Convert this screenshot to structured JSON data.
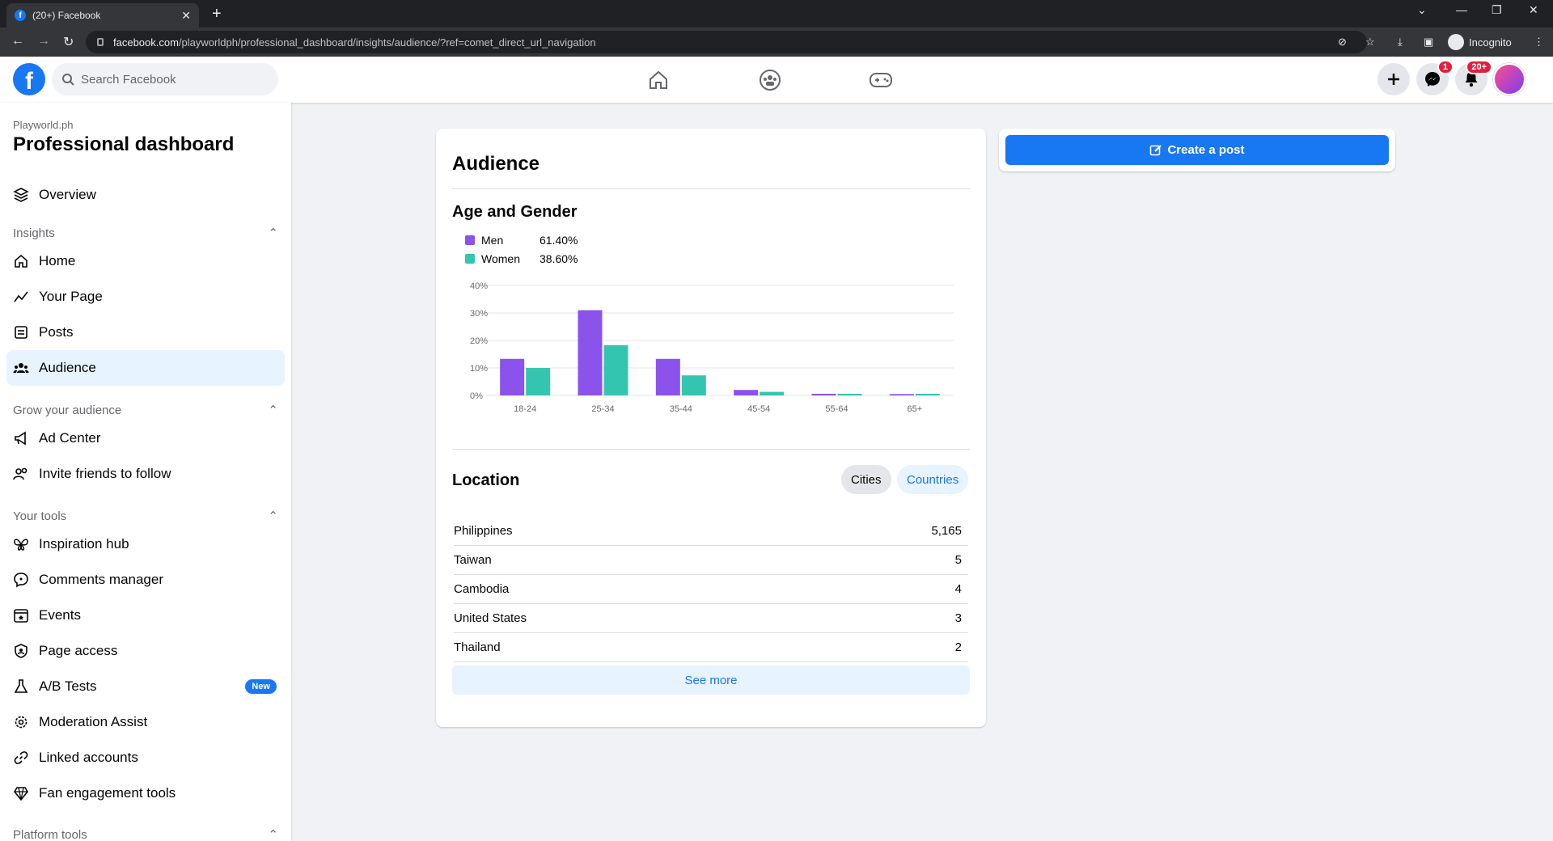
{
  "browser": {
    "tab_title": "(20+) Facebook",
    "url_host": "facebook.com",
    "url_path": "/playworldph/professional_dashboard/insights/audience/?ref=comet_direct_url_navigation",
    "incognito_label": "Incognito"
  },
  "fb_header": {
    "search_placeholder": "Search Facebook",
    "messenger_badge": "1",
    "notifications_badge": "20+"
  },
  "sidebar": {
    "page_name": "Playworld.ph",
    "title": "Professional dashboard",
    "overview": "Overview",
    "sections": {
      "insights": "Insights",
      "grow": "Grow your audience",
      "tools": "Your tools",
      "platform": "Platform tools"
    },
    "insights_items": [
      "Home",
      "Your Page",
      "Posts",
      "Audience"
    ],
    "grow_items": [
      "Ad Center",
      "Invite friends to follow"
    ],
    "tools_items": [
      "Inspiration hub",
      "Comments manager",
      "Events",
      "Page access",
      "A/B Tests",
      "Moderation Assist",
      "Linked accounts",
      "Fan engagement tools"
    ],
    "new_badge": "New"
  },
  "main": {
    "title": "Audience",
    "age_gender_title": "Age and Gender",
    "legend": [
      {
        "label": "Men",
        "value": "61.40%",
        "color": "#8c52ec"
      },
      {
        "label": "Women",
        "value": "38.60%",
        "color": "#34c5b1"
      }
    ],
    "location_title": "Location",
    "cities_label": "Cities",
    "countries_label": "Countries",
    "locations": [
      {
        "name": "Philippines",
        "count": "5,165"
      },
      {
        "name": "Taiwan",
        "count": "5"
      },
      {
        "name": "Cambodia",
        "count": "4"
      },
      {
        "name": "United States",
        "count": "3"
      },
      {
        "name": "Thailand",
        "count": "2"
      }
    ],
    "see_more": "See more"
  },
  "create_post_label": "Create a post",
  "chart_data": {
    "type": "bar",
    "categories": [
      "18-24",
      "25-34",
      "35-44",
      "45-54",
      "55-64",
      "65+"
    ],
    "series": [
      {
        "name": "Men",
        "values": [
          13.3,
          31,
          13.3,
          2,
          0.6,
          0.5
        ]
      },
      {
        "name": "Women",
        "values": [
          10,
          18.3,
          7.3,
          1.3,
          0.6,
          0.6
        ]
      }
    ],
    "yticks": [
      "0%",
      "10%",
      "20%",
      "30%",
      "40%"
    ],
    "ylim": [
      0,
      40
    ],
    "grid": true
  }
}
